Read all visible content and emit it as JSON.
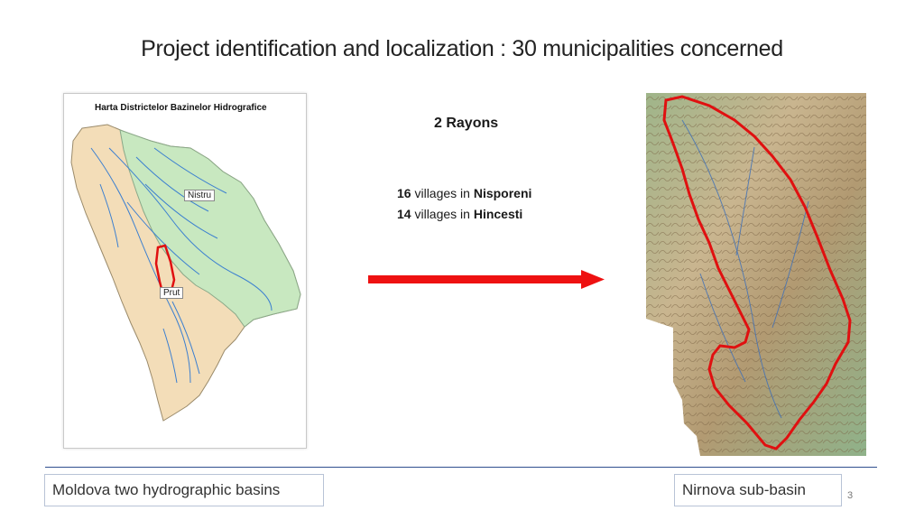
{
  "slide": {
    "title": "Project identification and localization : 30 municipalities concerned",
    "page_number": "3"
  },
  "left_map": {
    "heading": "Harta Districtelor Bazinelor Hidrografice",
    "label_nistru": "Nistru",
    "label_prut": "Prut",
    "colors": {
      "nistru_basin": "#c8e8c0",
      "prut_basin": "#f3ddb8",
      "river": "#3b7fd0",
      "highlight": "#e01010"
    }
  },
  "center": {
    "rayons_label": "2 Rayons",
    "villages": [
      {
        "count": "16",
        "text": " villages in ",
        "place": "Nisporeni"
      },
      {
        "count": "14",
        "text": " villages in ",
        "place": "Hincesti"
      }
    ],
    "arrow_color": "#ee1111"
  },
  "captions": {
    "left": "Moldova two hydrographic basins",
    "right": "Nirnova sub-basin"
  }
}
